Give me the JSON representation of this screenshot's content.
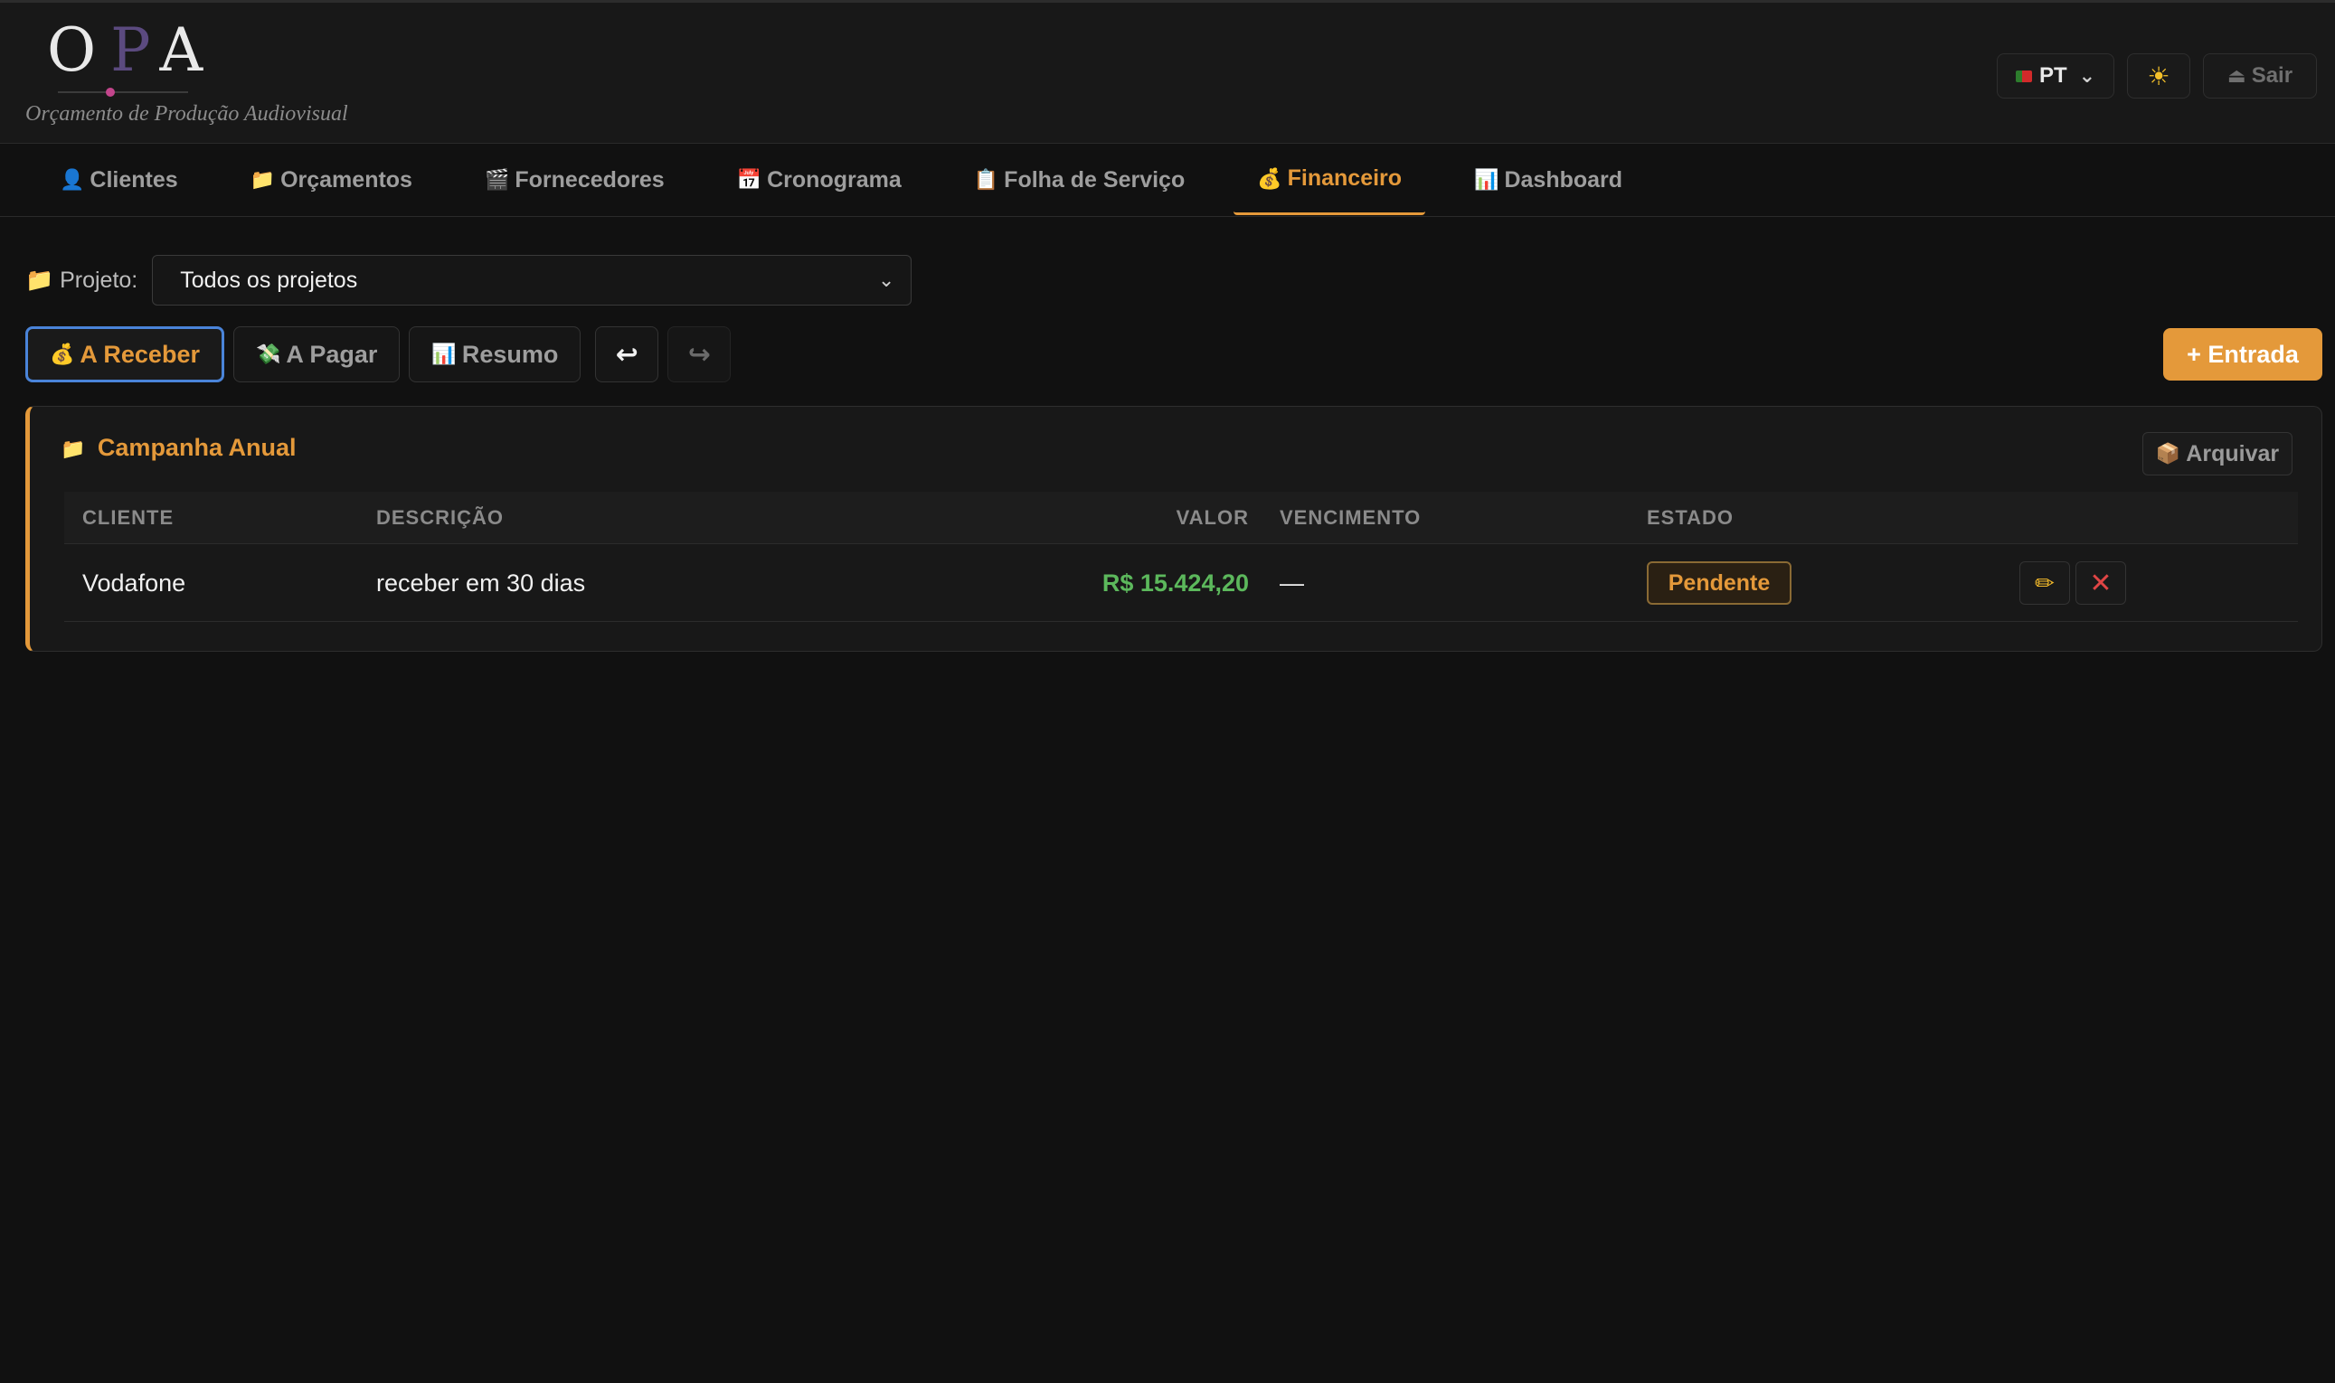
{
  "header": {
    "logo_letter_1": "O",
    "logo_letter_2": "P",
    "logo_letter_3": "A",
    "subtitle": "Orçamento de Produção Audiovisual",
    "language": "PT",
    "theme_icon": "☀",
    "logout_label": "Sair"
  },
  "tabs": [
    {
      "icon": "👤",
      "label": "Clientes"
    },
    {
      "icon": "📁",
      "label": "Orçamentos"
    },
    {
      "icon": "🎬",
      "label": "Fornecedores"
    },
    {
      "icon": "📅",
      "label": "Cronograma"
    },
    {
      "icon": "📋",
      "label": "Folha de Serviço"
    },
    {
      "icon": "💰",
      "label": "Financeiro"
    },
    {
      "icon": "📊",
      "label": "Dashboard"
    }
  ],
  "project_filter": {
    "icon": "📁",
    "label": "Projeto:",
    "selected": "Todos os projetos"
  },
  "subtabs": [
    {
      "icon": "💰",
      "label": "A Receber"
    },
    {
      "icon": "💸",
      "label": "A Pagar"
    },
    {
      "icon": "📊",
      "label": "Resumo"
    }
  ],
  "undo_icon": "↩",
  "redo_icon": "↪",
  "add_entry_label": "+ Entrada",
  "project_card": {
    "icon": "📁",
    "title": "Campanha Anual",
    "archive_icon": "📦",
    "archive_label": "Arquivar",
    "columns": [
      "CLIENTE",
      "DESCRIÇÃO",
      "VALOR",
      "VENCIMENTO",
      "ESTADO"
    ],
    "rows": [
      {
        "cliente": "Vodafone",
        "descricao": "receber em 30 dias",
        "valor": "R$ 15.424,20",
        "vencimento": "—",
        "estado": "Pendente"
      }
    ]
  },
  "colors": {
    "accent": "#e4993a",
    "background": "#111111",
    "value_green": "#5cb85c",
    "active_outline": "#4a84d9"
  }
}
